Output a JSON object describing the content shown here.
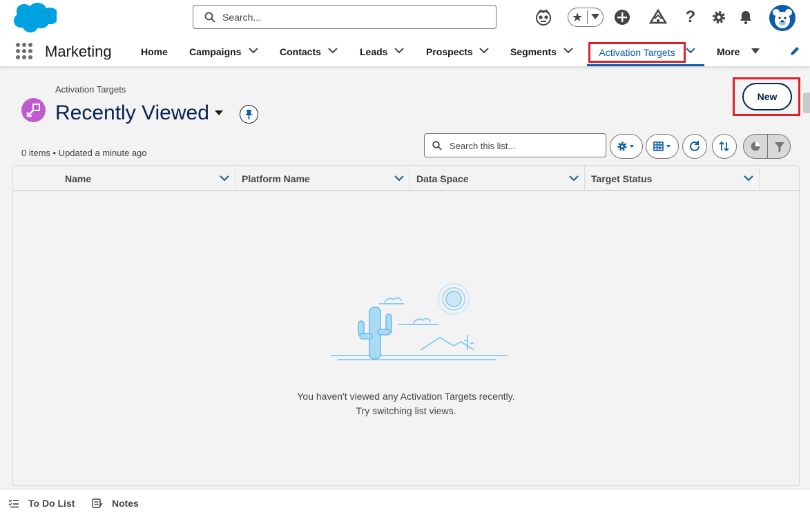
{
  "header": {
    "search_placeholder": "Search...",
    "icons": [
      "salesforce-logo",
      "einstein-icon",
      "favorites-star-icon",
      "global-add-icon",
      "trailhead-icon",
      "help-icon",
      "setup-gear-icon",
      "notifications-bell-icon",
      "user-avatar"
    ]
  },
  "nav": {
    "app_name": "Marketing",
    "items": [
      {
        "label": "Home",
        "has_menu": false
      },
      {
        "label": "Campaigns",
        "has_menu": true
      },
      {
        "label": "Contacts",
        "has_menu": true
      },
      {
        "label": "Leads",
        "has_menu": true
      },
      {
        "label": "Prospects",
        "has_menu": true
      },
      {
        "label": "Segments",
        "has_menu": true
      },
      {
        "label": "Activation Targets",
        "has_menu": true,
        "active": true
      },
      {
        "label": "More",
        "has_menu": true
      }
    ]
  },
  "list_view": {
    "object_label": "Activation Targets",
    "title": "Recently Viewed",
    "new_button": "New",
    "meta": "0 items • Updated a minute ago",
    "search_placeholder": "Search this list...",
    "columns": [
      "Name",
      "Platform Name",
      "Data Space",
      "Target Status"
    ],
    "empty_message_1": "You haven't viewed any Activation Targets recently.",
    "empty_message_2": "Try switching list views."
  },
  "utility_bar": {
    "items": [
      "To Do List",
      "Notes"
    ]
  },
  "colors": {
    "brand_blue": "#0b5cab",
    "salesforce_cloud": "#00a1e0",
    "highlight_red": "#e0202a",
    "object_icon": "#c15ad1"
  }
}
